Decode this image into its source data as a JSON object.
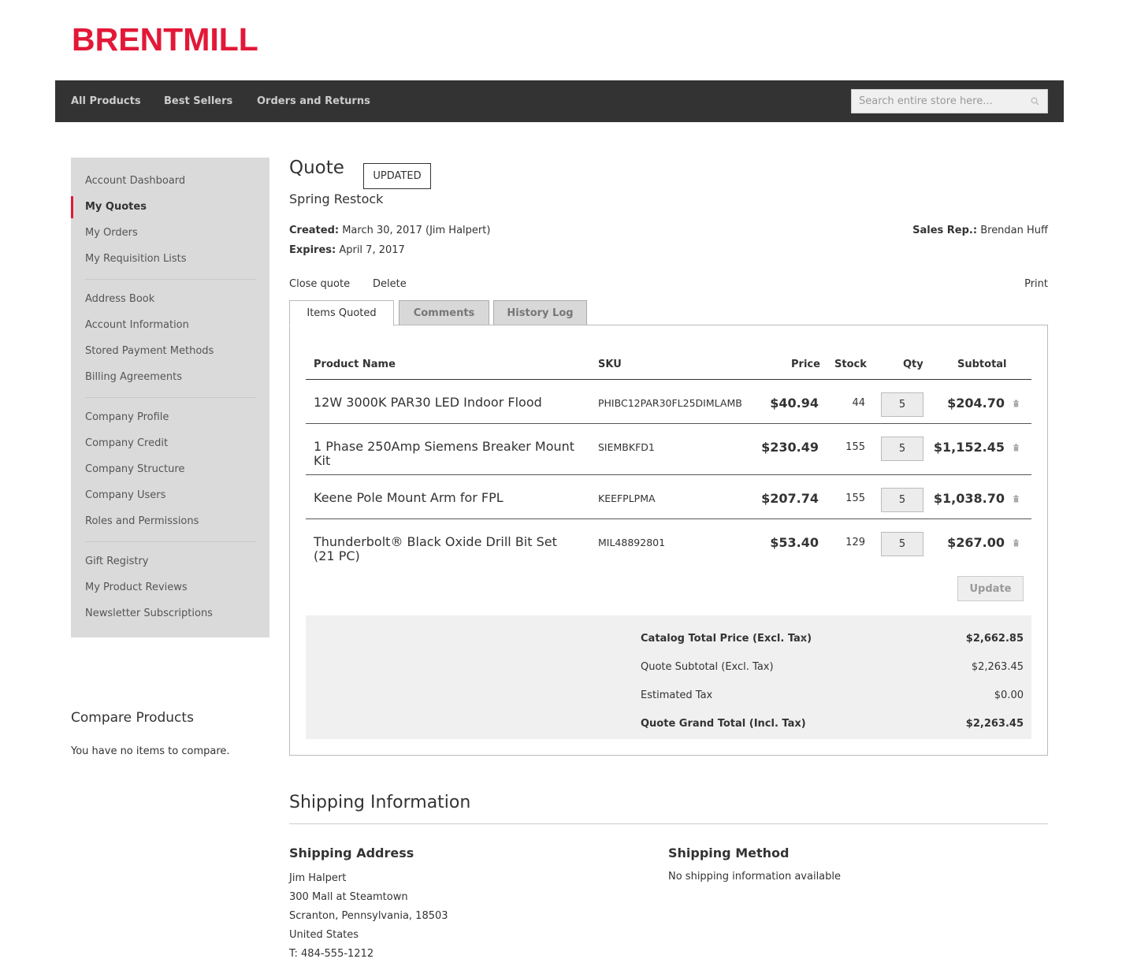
{
  "brand": {
    "logo": "BRENTMILL",
    "accent_color": "#e31837"
  },
  "nav": {
    "links": [
      "All Products",
      "Best Sellers",
      "Orders and Returns"
    ],
    "search": {
      "placeholder": "Search entire store here...",
      "icon": "search-icon"
    }
  },
  "sidebar": {
    "groups": [
      [
        "Account Dashboard",
        "My Quotes",
        "My Orders",
        "My Requisition Lists"
      ],
      [
        "Address Book",
        "Account Information",
        "Stored Payment Methods",
        "Billing Agreements"
      ],
      [
        "Company Profile",
        "Company Credit",
        "Company Structure",
        "Company Users",
        "Roles and Permissions"
      ],
      [
        "Gift Registry",
        "My Product Reviews",
        "Newsletter Subscriptions"
      ]
    ],
    "active": "My Quotes"
  },
  "compare": {
    "title": "Compare Products",
    "text": "You have no items to compare."
  },
  "quote": {
    "title": "Quote",
    "status": "UPDATED",
    "name": "Spring Restock",
    "created_label": "Created:",
    "created_value": " March 30, 2017 (Jim Halpert)",
    "expires_label": "Expires:",
    "expires_value": " April 7, 2017",
    "sales_rep_label": "Sales Rep.:",
    "sales_rep_value": " Brendan Huff",
    "actions": {
      "close": "Close quote",
      "delete": "Delete",
      "print": "Print"
    },
    "tabs": [
      "Items Quoted",
      "Comments",
      "History Log"
    ],
    "columns": {
      "name": "Product Name",
      "sku": "SKU",
      "price": "Price",
      "stock": "Stock",
      "qty": "Qty",
      "subtotal": "Subtotal"
    },
    "items": [
      {
        "name": "12W 3000K PAR30 LED Indoor Flood",
        "sku": "PHIBC12PAR30FL25DIMLAMB",
        "price": "$40.94",
        "stock": "44",
        "qty": "5",
        "subtotal": "$204.70"
      },
      {
        "name": "1 Phase 250Amp Siemens Breaker Mount Kit",
        "sku": "SIEMBKFD1",
        "price": "$230.49",
        "stock": "155",
        "qty": "5",
        "subtotal": "$1,152.45"
      },
      {
        "name": "Keene Pole Mount Arm for FPL",
        "sku": "KEEFPLPMA",
        "price": "$207.74",
        "stock": "155",
        "qty": "5",
        "subtotal": "$1,038.70"
      },
      {
        "name": "Thunderbolt® Black Oxide Drill Bit Set (21 PC)",
        "sku": "MIL48892801",
        "price": "$53.40",
        "stock": "129",
        "qty": "5",
        "subtotal": "$267.00"
      }
    ],
    "update_label": "Update",
    "totals": {
      "catalog_label": "Catalog Total Price (Excl. Tax)",
      "catalog_value": "$2,662.85",
      "subtotal_label": "Quote Subtotal (Excl. Tax)",
      "subtotal_value": "$2,263.45",
      "tax_label": "Estimated Tax",
      "tax_value": "$0.00",
      "grand_label": "Quote Grand Total (Incl. Tax)",
      "grand_value": "$2,263.45"
    }
  },
  "shipping": {
    "title": "Shipping Information",
    "address_title": "Shipping Address",
    "address_lines": [
      "Jim Halpert",
      "300 Mall at Steamtown",
      "Scranton, Pennsylvania, 18503",
      "United States",
      "T: 484-555-1212"
    ],
    "method_title": "Shipping Method",
    "method_text": "No shipping information available"
  }
}
